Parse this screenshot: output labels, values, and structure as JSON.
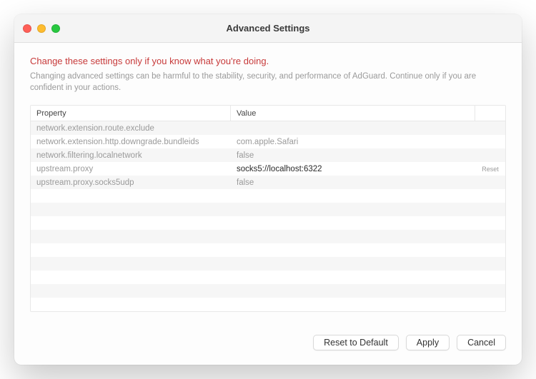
{
  "window": {
    "title": "Advanced Settings"
  },
  "warning": {
    "title": "Change these settings only if you know what you're doing.",
    "subtitle": "Changing advanced settings can be harmful to the stability, security, and performance of AdGuard. Continue only if you are confident in your actions."
  },
  "table": {
    "headers": {
      "property": "Property",
      "value": "Value"
    },
    "rows": [
      {
        "property": "network.extension.route.exclude",
        "value": "",
        "selected": false,
        "reset": ""
      },
      {
        "property": "network.extension.http.downgrade.bundleids",
        "value": "com.apple.Safari",
        "selected": false,
        "reset": ""
      },
      {
        "property": "network.filtering.localnetwork",
        "value": "false",
        "selected": false,
        "reset": ""
      },
      {
        "property": "upstream.proxy",
        "value": "socks5://localhost:6322",
        "selected": true,
        "reset": "Reset"
      },
      {
        "property": "upstream.proxy.socks5udp",
        "value": "false",
        "selected": false,
        "reset": ""
      },
      {
        "property": "",
        "value": "",
        "selected": false,
        "reset": ""
      },
      {
        "property": "",
        "value": "",
        "selected": false,
        "reset": ""
      },
      {
        "property": "",
        "value": "",
        "selected": false,
        "reset": ""
      },
      {
        "property": "",
        "value": "",
        "selected": false,
        "reset": ""
      },
      {
        "property": "",
        "value": "",
        "selected": false,
        "reset": ""
      },
      {
        "property": "",
        "value": "",
        "selected": false,
        "reset": ""
      },
      {
        "property": "",
        "value": "",
        "selected": false,
        "reset": ""
      },
      {
        "property": "",
        "value": "",
        "selected": false,
        "reset": ""
      },
      {
        "property": "",
        "value": "",
        "selected": false,
        "reset": ""
      }
    ]
  },
  "buttons": {
    "reset_default": "Reset to Default",
    "apply": "Apply",
    "cancel": "Cancel"
  }
}
